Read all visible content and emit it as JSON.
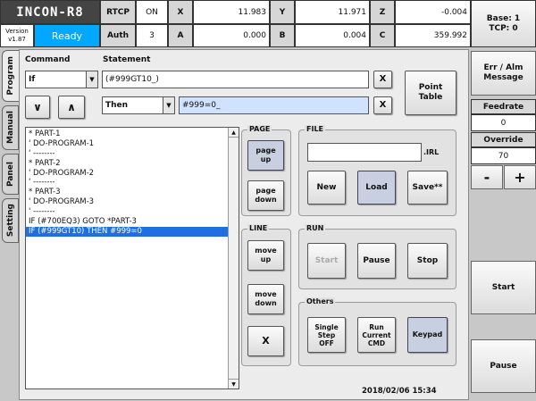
{
  "header": {
    "brand": "INCON-R8",
    "version_label": "Version",
    "version": "v1.87",
    "status": "Ready",
    "rtcp_label": "RTCP",
    "rtcp_value": "ON",
    "auth_label": "Auth",
    "auth_value": "3",
    "axes": {
      "x_label": "X",
      "x_value": "11.983",
      "y_label": "Y",
      "y_value": "11.971",
      "z_label": "Z",
      "z_value": "-0.004",
      "a_label": "A",
      "a_value": "0.000",
      "b_label": "B",
      "b_value": "0.004",
      "c_label": "C",
      "c_value": "359.992"
    },
    "base_tcp": [
      "Base: 1",
      "TCP: 0"
    ]
  },
  "side_tabs": [
    "Program",
    "Manual",
    "Panel",
    "Setting"
  ],
  "editor": {
    "command_label": "Command",
    "statement_label": "Statement",
    "command_value": "If",
    "statement1_value": "(#999GT10_)",
    "then_value": "Then",
    "statement2_value": "#999=0_",
    "clear_label": "X",
    "down_label": "∨",
    "up_label": "∧",
    "point_table_label": [
      "Point",
      "Table"
    ]
  },
  "program_lines": [
    "* PART-1",
    "' DO-PROGRAM-1",
    "' --------",
    "* PART-2",
    "' DO-PROGRAM-2",
    "' --------",
    "* PART-3",
    "' DO-PROGRAM-3",
    "' --------",
    "IF (#700EQ3) GOTO *PART-3",
    "IF (#999GT10) THEN #999=0"
  ],
  "selected_line": 10,
  "page_group": {
    "title": "PAGE",
    "page_up": [
      "page",
      "up"
    ],
    "page_down": [
      "page",
      "down"
    ]
  },
  "line_group": {
    "title": "LINE",
    "move_up": [
      "move",
      "up"
    ],
    "move_down": [
      "move",
      "down"
    ],
    "delete": "X"
  },
  "file_group": {
    "title": "FILE",
    "filename": "",
    "ext": ".IRL",
    "new": "New",
    "load": "Load",
    "save": "Save**"
  },
  "run_group": {
    "title": "RUN",
    "start": "Start",
    "pause": "Pause",
    "stop": "Stop"
  },
  "others_group": {
    "title": "Others",
    "single_step": [
      "Single",
      "Step",
      "OFF"
    ],
    "run_current": [
      "Run",
      "Current",
      "CMD"
    ],
    "keypad": "Keypad"
  },
  "datetime": "2018/02/06 15:34",
  "right_panel": {
    "err_alm": [
      "Err / Alm",
      "Message"
    ],
    "feedrate_label": "Feedrate",
    "feedrate_value": "0",
    "override_label": "Override",
    "override_value": "70",
    "minus": "-",
    "plus": "+",
    "start": "Start",
    "pause": "Pause"
  },
  "colors": {
    "status_bg": "#00a8ff",
    "selection": "#1f6fe0",
    "brand_bg": "#3a3a3a"
  }
}
